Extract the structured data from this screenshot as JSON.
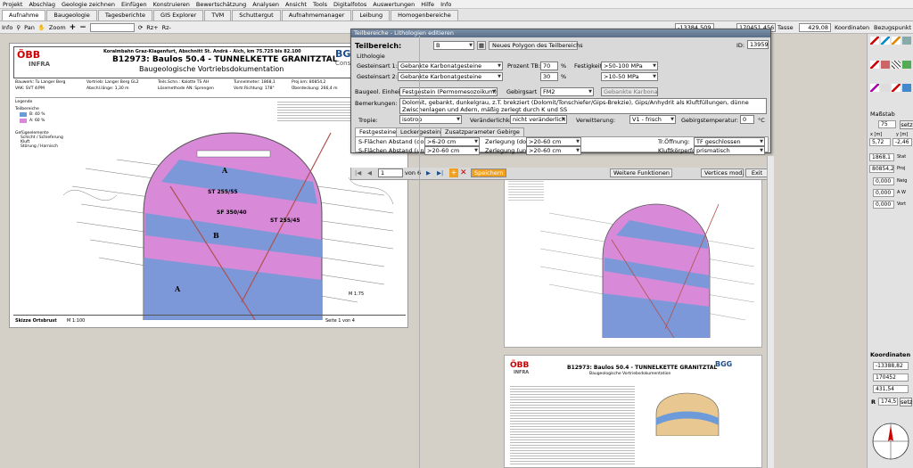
{
  "menu": [
    "Projekt",
    "Abschlag",
    "Geologie zeichnen",
    "Einfügen",
    "Konstruieren",
    "Bewertschätzung",
    "Analysen",
    "Ansicht",
    "Tools",
    "Digitalfotos",
    "Auswertungen",
    "Hilfe",
    "Info"
  ],
  "tabs": [
    "Aufnahme",
    "Baugeologie",
    "Tagesberichte",
    "GIS Explorer",
    "TVM",
    "Schuttergut",
    "Aufnahmemanager",
    "Leibung",
    "Homogenbereiche"
  ],
  "toolbar": {
    "info": "Info",
    "pan": "Pan",
    "zoom": "Zoom",
    "zoom_plus": "+",
    "zoom_minus": "−",
    "rz_plus": "Rz+",
    "rz_minus": "Rz-",
    "coord_x": "-13384,509",
    "coord_y": "170451,456",
    "sheet": "Tasse",
    "value": "429,08",
    "koordinaten": "Koordinaten",
    "bezugspunkt": "Bezugspunkt setzen"
  },
  "right_panel": {
    "massstab": "Maßstab",
    "massstab_val": "75",
    "set_btn": "setz",
    "x_label": "x [m]",
    "y_label": "y [m]",
    "x_val": "5,72",
    "y_val": "-2,46",
    "stat_val": "1868,1",
    "stat_lbl": "Stat",
    "proj_val": "80854,2",
    "proj_lbl": "Proj",
    "n1": "0,000",
    "n1_lbl": "Neig",
    "n2": "0,000",
    "n2_lbl": "A W",
    "n3": "0,000",
    "n3_lbl": "Vort",
    "koord_title": "Koordinaten",
    "k1": "-13388,82",
    "k2": "170452",
    "k3": "431,54",
    "r_lbl": "R",
    "r_val": "174,5",
    "r_btn": "setz"
  },
  "dialog": {
    "title": "Teilbereiche - Lithologien editieren",
    "teilbereich_lbl": "Teilbereich:",
    "teilbereich_val": "B",
    "new_polygon_btn": "Neues Polygon des Teilbereichs",
    "id_lbl": "ID:",
    "id_val": "13959",
    "lithologie": "Lithologie",
    "gestein1_lbl": "Gesteinsart 1:",
    "gestein1_val": "Gebankte Karbonatgesteine",
    "prozent_lbl": "Prozent TB:",
    "p1": "70",
    "pct": "%",
    "festigkeit_lbl": "Festigkeit:",
    "fest1": ">50-100 MPa",
    "gestein2_lbl": "Gesteinsart 2:",
    "gestein2_val": "Gebankte Karbonatgesteine",
    "p2": "30",
    "fest2": ">10-50 MPa",
    "baugeol_lbl": "Baugeol. Einheit:",
    "baugeol_val": "Festgestein (Permomesozoikum)",
    "gebirgsart_lbl": "Gebirgsart",
    "gebirgsart_val": "FM2",
    "gebirgsart_desc": "Gebankte Karbonatgesteine",
    "bemerkungen_lbl": "Bemerkungen:",
    "bemerkungen_val": "Dolomit, gebankt, dunkelgrau, z.T. brekziert (Dolomit/Tonschiefer/Gips-Brekzie), Gips/Anhydrit als Kluftfüllungen, dünne Zwischenlagen und Adern, mäßig zerlegt durch K und SS",
    "tropie_lbl": "Tropie:",
    "tropie_val": "isotrop",
    "veraend_lbl": "Veränderlichkeit:",
    "veraend_val": "nicht veränderlich",
    "verwitterung_lbl": "Verwitterung:",
    "verwitterung_val": "V1 - frisch",
    "temp_lbl": "Gebirgstemperatur:",
    "temp_val": "0",
    "temp_unit": "°C",
    "tab1": "Festgesteine",
    "tab2": "Lockergesteine",
    "tab3": "Zusatzparameter Gebirge",
    "sfd_lbl": "S-Flächen Abstand (dom.):",
    "sfd_val": ">6-20 cm",
    "zerd_lbl": "Zerlegung (dom.):",
    "zerd_val": ">20-60 cm",
    "troff_lbl": "Tr.Öffnung:",
    "troff_val": "TF geschlossen",
    "sfu_lbl": "S-Flächen Abstand (unt.):",
    "sfu_val": ">20-60 cm",
    "zeru_lbl": "Zerlegung (unt.):",
    "zeru_val": ">20-60 cm",
    "kluft_lbl": "Kluftkörperform:",
    "kluft_val": "prismatisch",
    "page_val": "1",
    "page_of": "von 6",
    "save_btn": "Speichern",
    "more_btn": "Weitere Funktionen",
    "vertices_btn": "Vertices mod.",
    "exit_btn": "Exit"
  },
  "sheet": {
    "logo": "ÖBB",
    "logo_sub": "INFRA",
    "bgg": "BGG",
    "bgg_sub": "Consult",
    "header1": "Koralmbahn Graz-Klagenfurt, Abschnitt St. Andrä - Aich, km 75.725 bis 82.100",
    "header2": "B12973: Baulos 50.4 - TUNNELKETTE GRANITZTAL",
    "header3": "Baugeologische Vortriebsdokumentation",
    "bauwerk": "Bauwerk: Tu Langer Berg",
    "vortrieb": "Vortrieb: Langer Berg GL2",
    "teils": "Teils.Schn.: Kalotte TS AH",
    "tunnelmeter": "Tunnelmeter: 1868,1",
    "projkm": "Proj.km: 80854,2",
    "vak": "VAK: SVT 4/PM",
    "abschl": "Abschl.länge: 1,30 m",
    "loesemeth": "Lösemethode AN: Sprengen",
    "vortrrichtung": "Vortr.Richtung: 178°",
    "ueberdeckung": "Überdeckung: 266,4 m",
    "legende": "Legende",
    "teilbereiche": "Teilbereiche",
    "leg_b": "B: 40 %",
    "leg_a": "A: 60 %",
    "gefuege": "Gefügeelemente",
    "g1": "Schicht / Schieferung",
    "g2": "Kluft",
    "g3": "Störung / Harnisch",
    "label_a": "A",
    "label_b": "B",
    "st1": "ST 255/55",
    "st2": "ST 255/45",
    "sf": "SF 350/40",
    "scale": "M 1:75",
    "footer_left": "Skizze Ortsbrust",
    "footer_scale": "M 1:100",
    "footer_page": "Seite 1 von 4"
  },
  "colors": {
    "pink": "#d88ad8",
    "blue": "#6d9ad8",
    "accent": "#f0a020",
    "title_bar": "#5a6e88"
  }
}
